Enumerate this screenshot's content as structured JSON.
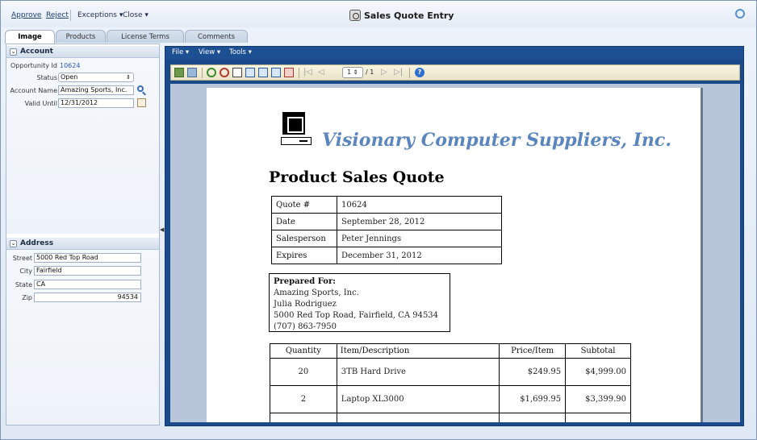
{
  "toolbar": {
    "approve": "Approve",
    "reject": "Reject",
    "exceptions": "Exceptions",
    "close": "Close",
    "title": "Sales Quote Entry"
  },
  "tabs": [
    {
      "label": "Image"
    },
    {
      "label": "Products"
    },
    {
      "label": "License Terms"
    },
    {
      "label": "Comments"
    }
  ],
  "account": {
    "header": "Account",
    "opportunity_label": "Opportunity Id",
    "opportunity_value": "10624",
    "status_label": "Status",
    "status_value": "Open",
    "account_name_label": "Account Name",
    "account_name_value": "Amazing Sports, Inc.",
    "valid_until_label": "Valid Until",
    "valid_until_value": "12/31/2012"
  },
  "address": {
    "header": "Address",
    "street_label": "Street",
    "street_value": "5000 Red Top Road",
    "city_label": "City",
    "city_value": "Fairfield",
    "state_label": "State",
    "state_value": "CA",
    "zip_label": "Zip",
    "zip_value": "94534"
  },
  "viewer": {
    "menu_file": "File",
    "menu_view": "View",
    "menu_tools": "Tools",
    "page_current": "1",
    "page_total": "/ 1"
  },
  "document": {
    "company": "Visionary Computer Suppliers, Inc.",
    "title": "Product Sales Quote",
    "quote_info": [
      {
        "key": "Quote #",
        "value": "10624"
      },
      {
        "key": "Date",
        "value": "September 28, 2012"
      },
      {
        "key": "Salesperson",
        "value": "Peter Jennings"
      },
      {
        "key": "Expires",
        "value": "December 31, 2012"
      }
    ],
    "prepared_for": {
      "heading": "Prepared For:",
      "line1": "Amazing Sports, Inc.",
      "line2": "Julia Rodriguez",
      "line3": "5000 Red Top Road, Fairfield, CA 94534",
      "line4": "(707) 863-7950"
    },
    "items_headers": {
      "quantity": "Quantity",
      "item": "Item/Description",
      "price": "Price/Item",
      "subtotal": "Subtotal"
    },
    "items": [
      {
        "quantity": "20",
        "item": "3TB Hard Drive",
        "price": "$249.95",
        "subtotal": "$4,999.00"
      },
      {
        "quantity": "2",
        "item": "Laptop XL3000",
        "price": "$1,699.95",
        "subtotal": "$3,399.90"
      }
    ]
  }
}
